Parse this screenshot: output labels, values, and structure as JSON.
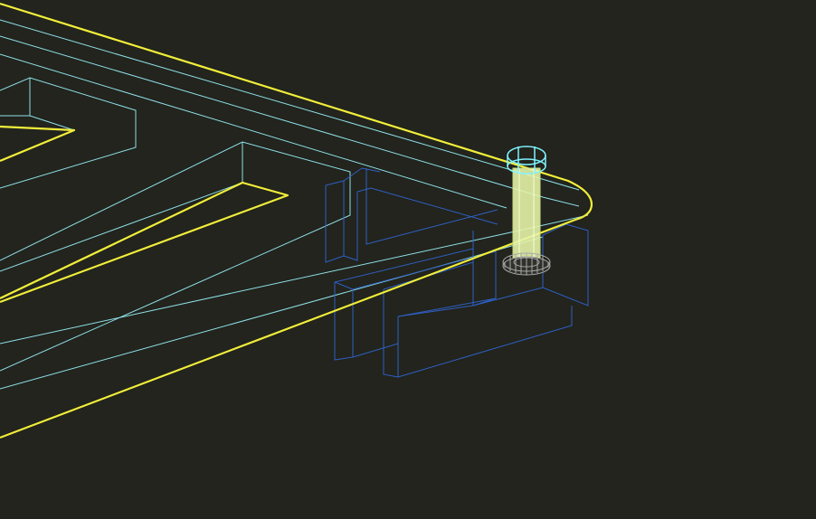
{
  "viewport": {
    "background": "#22241d",
    "render_mode": "wireframe",
    "colors": {
      "selected_edge": "#f2ee3a",
      "panel_edge": "#8fdfe8",
      "bracket_edge": "#2f5fc4",
      "bolt_shaft": "#e4f3a8",
      "bolt_head": "#7ef3ff",
      "washer": "#a9a9a9"
    },
    "objects": [
      {
        "id": "panel",
        "label": "frame-panel",
        "selected": true
      },
      {
        "id": "bracket",
        "label": "mounting-bracket",
        "selected": false
      },
      {
        "id": "bolt",
        "label": "hex-bolt",
        "selected": false
      },
      {
        "id": "washer",
        "label": "washer",
        "selected": false
      }
    ]
  }
}
